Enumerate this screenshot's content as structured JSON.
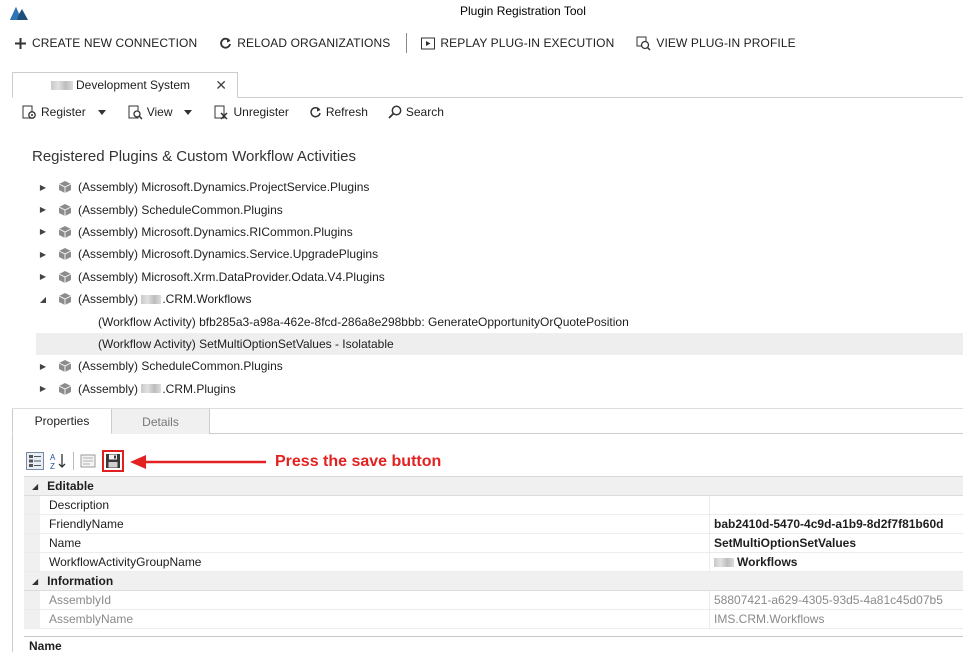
{
  "window": {
    "title": "Plugin Registration Tool"
  },
  "main_toolbar": {
    "create": "CREATE NEW CONNECTION",
    "reload": "RELOAD ORGANIZATIONS",
    "replay": "REPLAY PLUG-IN EXECUTION",
    "profile": "VIEW PLUG-IN PROFILE"
  },
  "connection_tab": {
    "label": "Development System",
    "close": "✕"
  },
  "sub_toolbar": {
    "register": "Register",
    "view": "View",
    "unregister": "Unregister",
    "refresh": "Refresh",
    "search": "Search"
  },
  "tree": {
    "title": "Registered Plugins & Custom Workflow Activities",
    "nodes": [
      {
        "label": "(Assembly) Microsoft.Dynamics.ProjectService.Plugins"
      },
      {
        "label": "(Assembly) ScheduleCommon.Plugins"
      },
      {
        "label": "(Assembly) Microsoft.Dynamics.RICommon.Plugins"
      },
      {
        "label": "(Assembly) Microsoft.Dynamics.Service.UpgradePlugins"
      },
      {
        "label": "(Assembly) Microsoft.Xrm.DataProvider.Odata.V4.Plugins"
      },
      {
        "label_prefix": "(Assembly) ",
        "label_suffix": ".CRM.Workflows"
      },
      {
        "label": "(Workflow Activity) bfb285a3-a98a-462e-8fcd-286a8e298bbb: GenerateOpportunityOrQuotePosition"
      },
      {
        "label": "(Workflow Activity) SetMultiOptionSetValues - Isolatable"
      },
      {
        "label": "(Assembly) ScheduleCommon.Plugins"
      },
      {
        "label_prefix": "(Assembly) ",
        "label_suffix": ".CRM.Plugins"
      }
    ]
  },
  "prop_tabs": {
    "properties": "Properties",
    "details": "Details"
  },
  "annotation": {
    "text": "Press the save button"
  },
  "grid": {
    "editable": "Editable",
    "information": "Information",
    "rows": {
      "description": {
        "name": "Description",
        "value": ""
      },
      "friendly": {
        "name": "FriendlyName",
        "value": "bab2410d-5470-4c9d-a1b9-8d2f7f81b60d"
      },
      "name": {
        "name": "Name",
        "value": "SetMultiOptionSetValues"
      },
      "group": {
        "name": "WorkflowActivityGroupName",
        "value": "Workflows"
      },
      "assemblyid": {
        "name": "AssemblyId",
        "value": "58807421-a629-4305-93d5-4a81c45d07b5"
      },
      "assemblyname": {
        "name": "AssemblyName",
        "value": "IMS.CRM.Workflows"
      }
    }
  },
  "description_pane": {
    "title": "Name"
  },
  "colors": {
    "annotation_red": "#e32121",
    "selected_row": "#eeeeee",
    "category_bg": "#f0f0f0"
  }
}
